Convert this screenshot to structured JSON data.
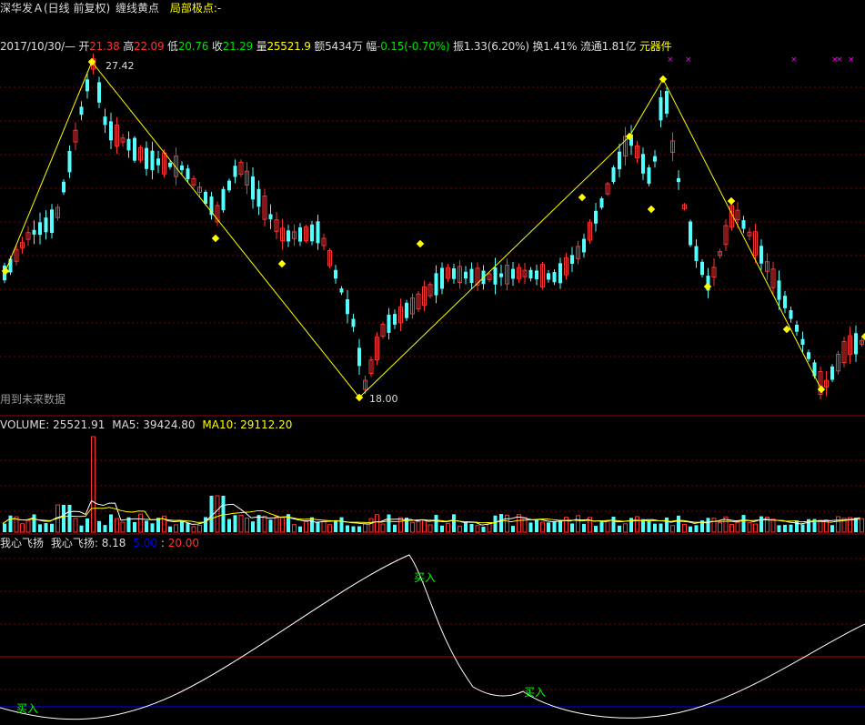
{
  "header": {
    "stock_name": "深华发Ａ(日线 前复权)",
    "indicator": "缠线黄点",
    "local_label": "局部极点:",
    "local_value": "-"
  },
  "info": {
    "date": "2017/10/30/—",
    "open_label": "开",
    "open": "21.38",
    "high_label": "高",
    "high": "22.09",
    "low_label": "低",
    "low": "20.76",
    "close_label": "收",
    "close": "21.29",
    "vol_label": "量",
    "vol": "25521.9",
    "amount_label": "额",
    "amount": "5434万",
    "change_label": "幅",
    "change": "-0.15(-0.70%)",
    "amp_label": "振",
    "amp": "1.33(6.20%)",
    "turn_label": "换",
    "turn": "1.41%",
    "float_label": "流通",
    "float": "1.81亿",
    "sector": "元器件"
  },
  "price_panel": {
    "high_label": "27.42",
    "low_label": "18.00",
    "future_note": "用到未来数据",
    "colors": {
      "up": "#ff3232",
      "down": "#54ffff",
      "zigzag": "#ffff00",
      "grid": "#800000",
      "marker": "#ff00ff"
    }
  },
  "volume_panel": {
    "title": "VOLUME:",
    "volume": "25521.91",
    "ma5_label": "MA5:",
    "ma5": "39424.80",
    "ma10_label": "MA10:",
    "ma10": "29112.20"
  },
  "indicator_panel": {
    "name": "我心飞扬",
    "label": "我心飞扬:",
    "value": "8.18",
    "low_line": "5.00",
    "high_line": "20.00",
    "buy_signal": "买入",
    "colors": {
      "curve": "#ffffff",
      "low_line": "#0000ff",
      "high_line": "#c00000",
      "signal": "#00ff00"
    }
  }
}
